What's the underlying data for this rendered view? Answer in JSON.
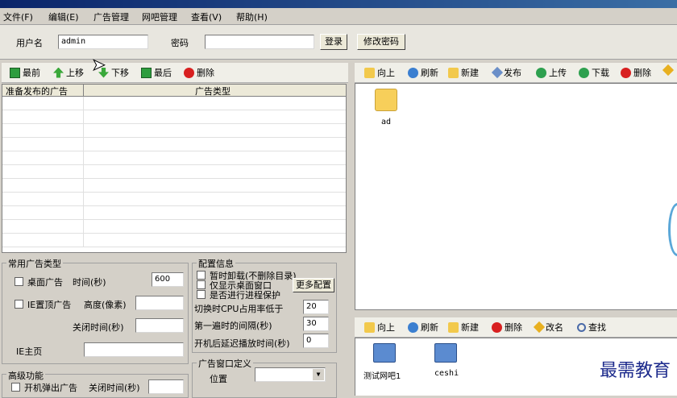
{
  "menu": {
    "file": "文件(F)",
    "edit": "编辑(E)",
    "ad_manage": "广告管理",
    "netbar_manage": "网吧管理",
    "view": "查看(V)",
    "help": "帮助(H)"
  },
  "login": {
    "username_label": "用户名",
    "username_value": "admin",
    "password_label": "密码",
    "password_value": "",
    "login_button": "登录",
    "change_password_button": "修改密码"
  },
  "left_toolbar": {
    "first": "最前",
    "up": "上移",
    "down": "下移",
    "last": "最后",
    "delete": "删除"
  },
  "grid": {
    "col1": "准备发布的广告",
    "col2": "广告类型",
    "rows": 11
  },
  "common_ad": {
    "title": "常用广告类型",
    "desktop_ad": "桌面广告",
    "time_label": "时间(秒)",
    "time_value": "600",
    "ie_top_ad": "IE置顶广告",
    "height_label": "高度(像素)",
    "close_time_label": "关闭时间(秒)",
    "ie_homepage_label": "IE主页"
  },
  "advanced": {
    "title": "高级功能",
    "boot_popup": "开机弹出广告",
    "close_time_label": "关闭时间(秒)"
  },
  "config": {
    "title": "配置信息",
    "temp_unload": "暂时卸载(不删除目录)",
    "desktop_only": "仅显示桌面窗口",
    "process_protect": "是否进行进程保护",
    "more_config": "更多配置",
    "cpu_label": "切换时CPU占用率低于",
    "cpu_value": "20",
    "first_interval_label": "第一遍时的间隔(秒)",
    "first_interval_value": "30",
    "boot_delay_label": "开机后延迟播放时间(秒)",
    "boot_delay_value": "0"
  },
  "ad_window": {
    "title": "广告窗口定义",
    "position_label": "位置"
  },
  "right_toolbar": {
    "up": "向上",
    "refresh": "刷新",
    "new": "新建",
    "publish": "发布",
    "upload": "上传",
    "download": "下载",
    "delete": "删除"
  },
  "files": [
    {
      "name": "ad",
      "icon": "folder-icon"
    }
  ],
  "bottom_toolbar": {
    "up": "向上",
    "refresh": "刷新",
    "new": "新建",
    "delete": "删除",
    "rename": "改名",
    "find": "查找"
  },
  "netbars": [
    {
      "name": "测试网吧1",
      "icon": "computer-icon"
    },
    {
      "name": "ceshi",
      "icon": "computer-icon"
    }
  ],
  "watermark": "最需教育"
}
